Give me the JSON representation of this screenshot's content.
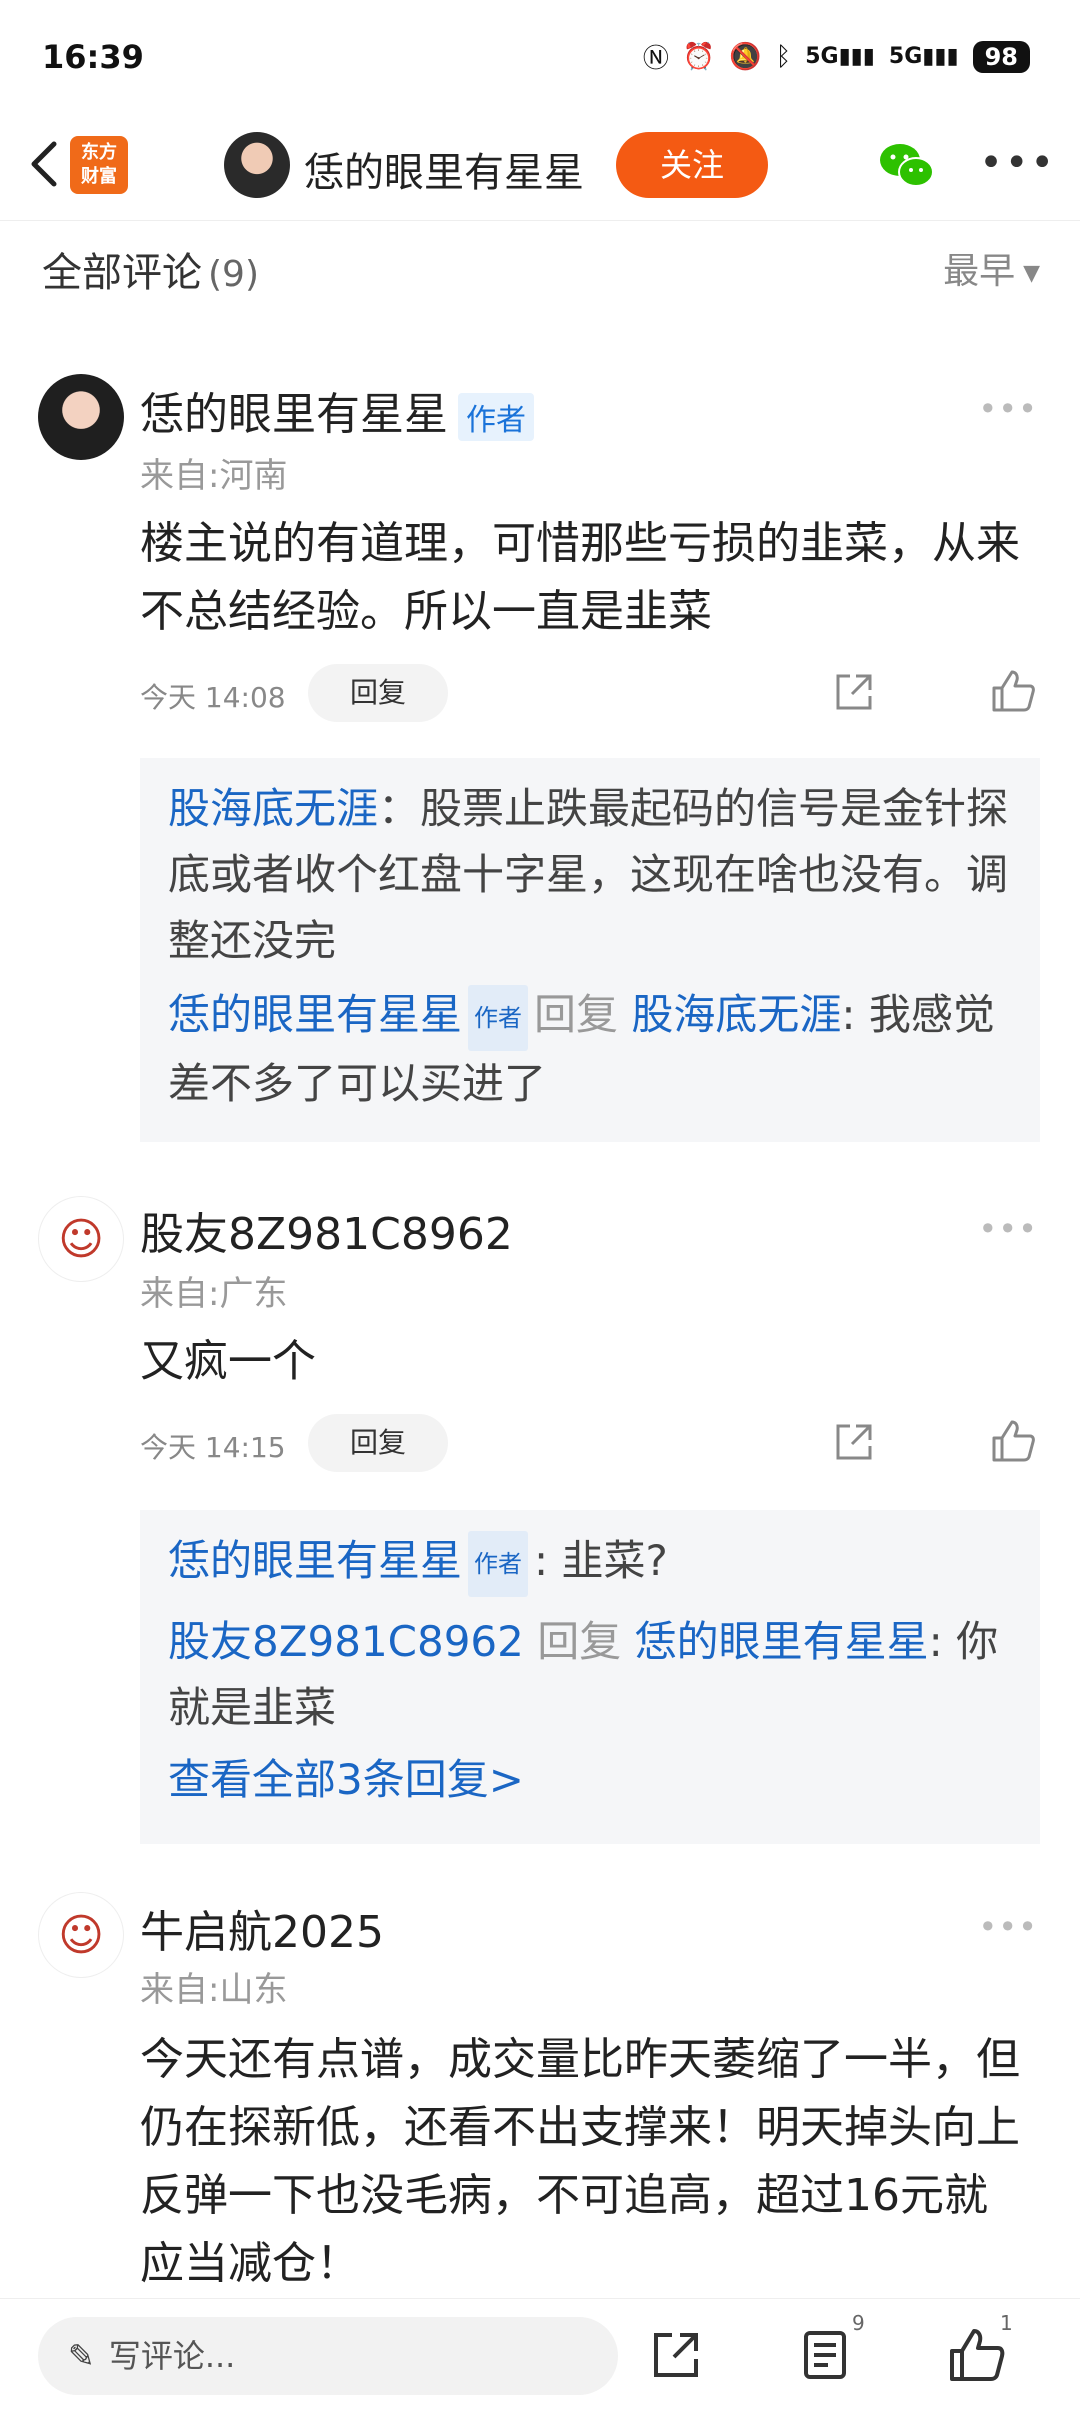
{
  "status_bar": {
    "time": "16:39",
    "net": "5G",
    "battery": "98"
  },
  "header": {
    "logo_line1": "东方",
    "logo_line2": "财富",
    "name": "恁的眼里有星星",
    "follow_label": "关注"
  },
  "comments_header": {
    "title": "全部评论",
    "count": "(9)",
    "sort": "最早"
  },
  "comments": [
    {
      "name": "恁的眼里有星星",
      "author_tag": "作者",
      "location": "来自:河南",
      "text": "楼主说的有道理，可惜那些亏损的韭菜，从来不总结经验。所以一直是韭菜",
      "time": "今天 14:08",
      "reply_label": "回复",
      "replies": {
        "r1_user": "股海底无涯",
        "r1_text": "：股票止跌最起码的信号是金针探底或者收个红盘十字星，这现在啥也没有。调整还没完",
        "r2_user": "恁的眼里有星星",
        "r2_tag": "作者",
        "r2_mid": "回复",
        "r2_target": "股海底无涯",
        "r2_text": ": 我感觉差不多了可以买进了"
      }
    },
    {
      "name": "股友8Z981C8962",
      "location": "来自:广东",
      "text": "又疯一个",
      "time": "今天 14:15",
      "reply_label": "回复",
      "replies": {
        "r1_user": "恁的眼里有星星",
        "r1_tag": "作者",
        "r1_text": ": 韭菜?",
        "r2_user": "股友8Z981C8962",
        "r2_mid": "回复",
        "r2_target": "恁的眼里有星星",
        "r2_text": ": 你就是韭菜",
        "more": "查看全部3条回复>"
      }
    },
    {
      "name": "牛启航2025",
      "location": "来自:山东",
      "text": "今天还有点谱，成交量比昨天萎缩了一半，但仍在探新低，还看不出支撑来！明天掉头向上反弹一下也没毛病，不可追高，超过16元就应当减仓！"
    }
  ],
  "bottom_bar": {
    "placeholder": "写评论...",
    "comment_count": "9",
    "like_count": "1"
  },
  "colors": {
    "accent": "#f45a13",
    "link": "#1a66c4"
  }
}
